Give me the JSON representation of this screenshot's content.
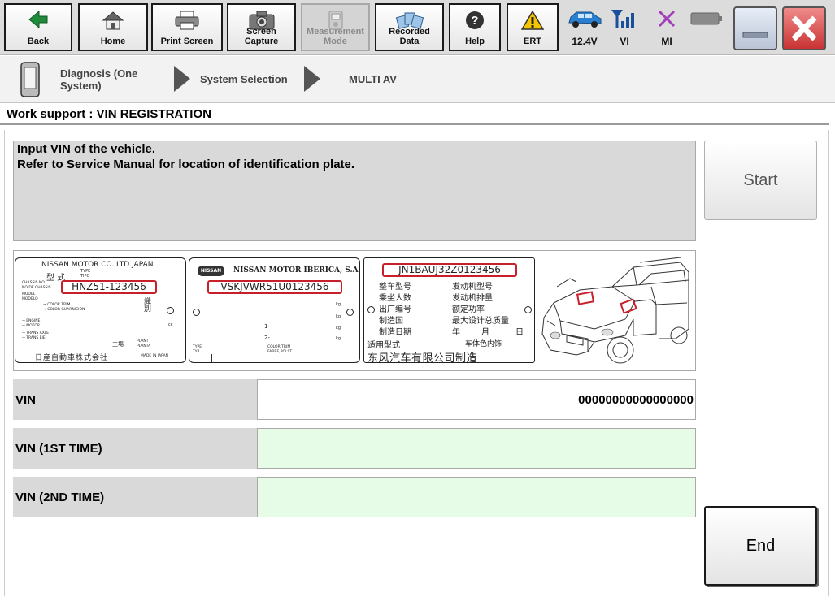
{
  "toolbar": {
    "back": "Back",
    "home": "Home",
    "print_screen": "Print Screen",
    "screen_capture": "Screen Capture",
    "measurement_mode": "Measurement Mode",
    "recorded_data": "Recorded Data",
    "help": "Help",
    "ert": "ERT",
    "status": {
      "voltage": "12.4V",
      "vi": "VI",
      "mi": "MI"
    }
  },
  "breadcrumb": {
    "step1": "Diagnosis (One System)",
    "step2": "System Selection",
    "step3": "MULTI AV"
  },
  "page_title": "Work support : VIN REGISTRATION",
  "instructions": {
    "line1": "Input VIN of the vehicle.",
    "line2": "Refer to Service Manual for location of identification plate."
  },
  "start_label": "Start",
  "end_label": "End",
  "plates": {
    "plate1": {
      "maker": "NISSAN MOTOR CO.,LTD.JAPAN",
      "type_kanji": "型 式",
      "type_label": "TYPE",
      "tipo_label": "TIPO",
      "chassis_label1": "CHASSIS NO",
      "chassis_label2": "NO DE CHASSIS",
      "model_label1": "MODEL",
      "model_label2": "MODELO",
      "trim_label": "→ COLOR TRIM",
      "trim_label2": "→ COLOR GUARNICION",
      "engine_label1": "→ ENGINE",
      "engine_label2": "→ MOTOR",
      "axle_label1": "→ TRANS AXLE",
      "axle_label2": "→ TRANS EJE",
      "kanji_right": "識別",
      "cc": "cc",
      "plant_kanji": "工場",
      "plant_label": "PLANT",
      "planta_label": "PLANTA",
      "maker_jp": "日産自動車株式会社",
      "made_in": "MADE IN JAPAN",
      "vin": "HNZ51-123456"
    },
    "plate2": {
      "logo": "NISSAN",
      "maker": "NISSAN MOTOR IBERICA, S.A.",
      "vin": "VSKJVWR51U0123456",
      "kg": "kg",
      "axle1": "1-",
      "axle2": "2-",
      "type_label": "TYPE",
      "typ_label": "TYP",
      "trim_label": "COLOR,TRIM",
      "trim_label2": "FARBE,POLST"
    },
    "plate3": {
      "vin": "JN1BAUJ32Z0123456",
      "row1_left": "整车型号",
      "row1_right": "发动机型号",
      "row2_left": "乘坐人数",
      "row2_right": "发动机排量",
      "row3_left": "出厂编号",
      "row3_right": "额定功率",
      "row4_left": "制造国",
      "row4_right": "最大设计总质量",
      "row5_left": "制造日期",
      "row5_year": "年",
      "row5_month": "月",
      "row5_day": "日",
      "row6_left": "适用型式",
      "row6_right": "车体色内饰",
      "maker": "东风汽车有限公司制造"
    }
  },
  "vin_fields": {
    "vin_label": "VIN",
    "vin_value": "00000000000000000",
    "vin1_label": "VIN (1ST TIME)",
    "vin1_value": "",
    "vin2_label": "VIN (2ND TIME)",
    "vin2_value": ""
  },
  "colors": {
    "input_bg": "#e6fce6",
    "label_bg": "#d9d9d9",
    "vin_frame": "#c8202a",
    "close_red": "#d93a3a",
    "car_blue": "#2a7fd0",
    "mi_purple": "#a33fb8",
    "warn_yellow": "#f5c400"
  }
}
